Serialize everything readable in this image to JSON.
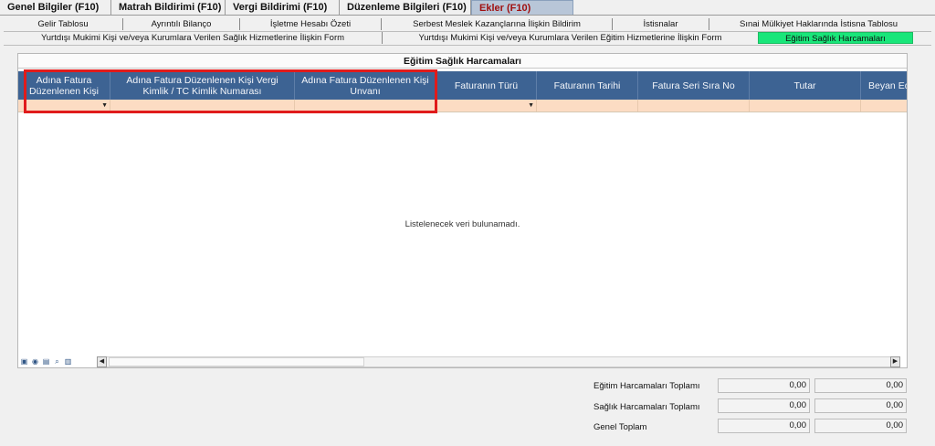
{
  "main_tabs": [
    "Genel Bilgiler (F10)",
    "Matrah Bildirimi (F10)",
    "Vergi Bildirimi (F10)",
    "Düzenleme Bilgileri  (F10)",
    "Ekler (F10)"
  ],
  "sub_tabs_row1": [
    "Gelir Tablosu",
    "Ayrıntılı Bilanço",
    "İşletme Hesabı Özeti",
    "Serbest Meslek Kazançlarına İlişkin Bildirim",
    "İstisnalar",
    "Sınai Mülkiyet Haklarında İstisna Tablosu"
  ],
  "sub_tabs_row2": [
    "Yurtdışı Mukimi Kişi ve/veya Kurumlara Verilen Sağlık Hizmetlerine İlişkin Form",
    "Yurtdışı Mukimi Kişi ve/veya Kurumlara Verilen Eğitim Hizmetlerine İlişkin Form",
    "Eğitim Sağlık Harcamaları"
  ],
  "panel": {
    "title": "Eğitim Sağlık Harcamaları",
    "empty_message": "Listelenecek veri bulunamadı."
  },
  "grid": {
    "columns": [
      "Adına Fatura Düzenlenen Kişi",
      "Adına Fatura Düzenlenen Kişi Vergi Kimlik / TC Kimlik Numarası",
      "Adına Fatura Düzenlenen Kişi Unvanı",
      "Faturanın Türü",
      "Faturanın Tarihi",
      "Fatura Seri Sıra No",
      "Tutar",
      "Beyan Ed"
    ]
  },
  "footer_icons": [
    "save-icon",
    "view-icon",
    "filter-icon",
    "search-icon",
    "print-icon"
  ],
  "totals": {
    "egitim_label": "Eğitim Harcamaları Toplamı",
    "saglik_label": "Sağlık Harcamaları Toplamı",
    "genel_label": "Genel Toplam",
    "egitim_value_1": "0,00",
    "egitim_value_2": "0,00",
    "saglik_value_1": "0,00",
    "saglik_value_2": "0,00",
    "genel_value_1": "0,00",
    "genel_value_2": "0,00"
  },
  "colors": {
    "header_bg": "#3d6393",
    "filter_bg": "#fcdcc3",
    "active_subtab": "#19e67a",
    "highlight": "#e01b1b"
  }
}
